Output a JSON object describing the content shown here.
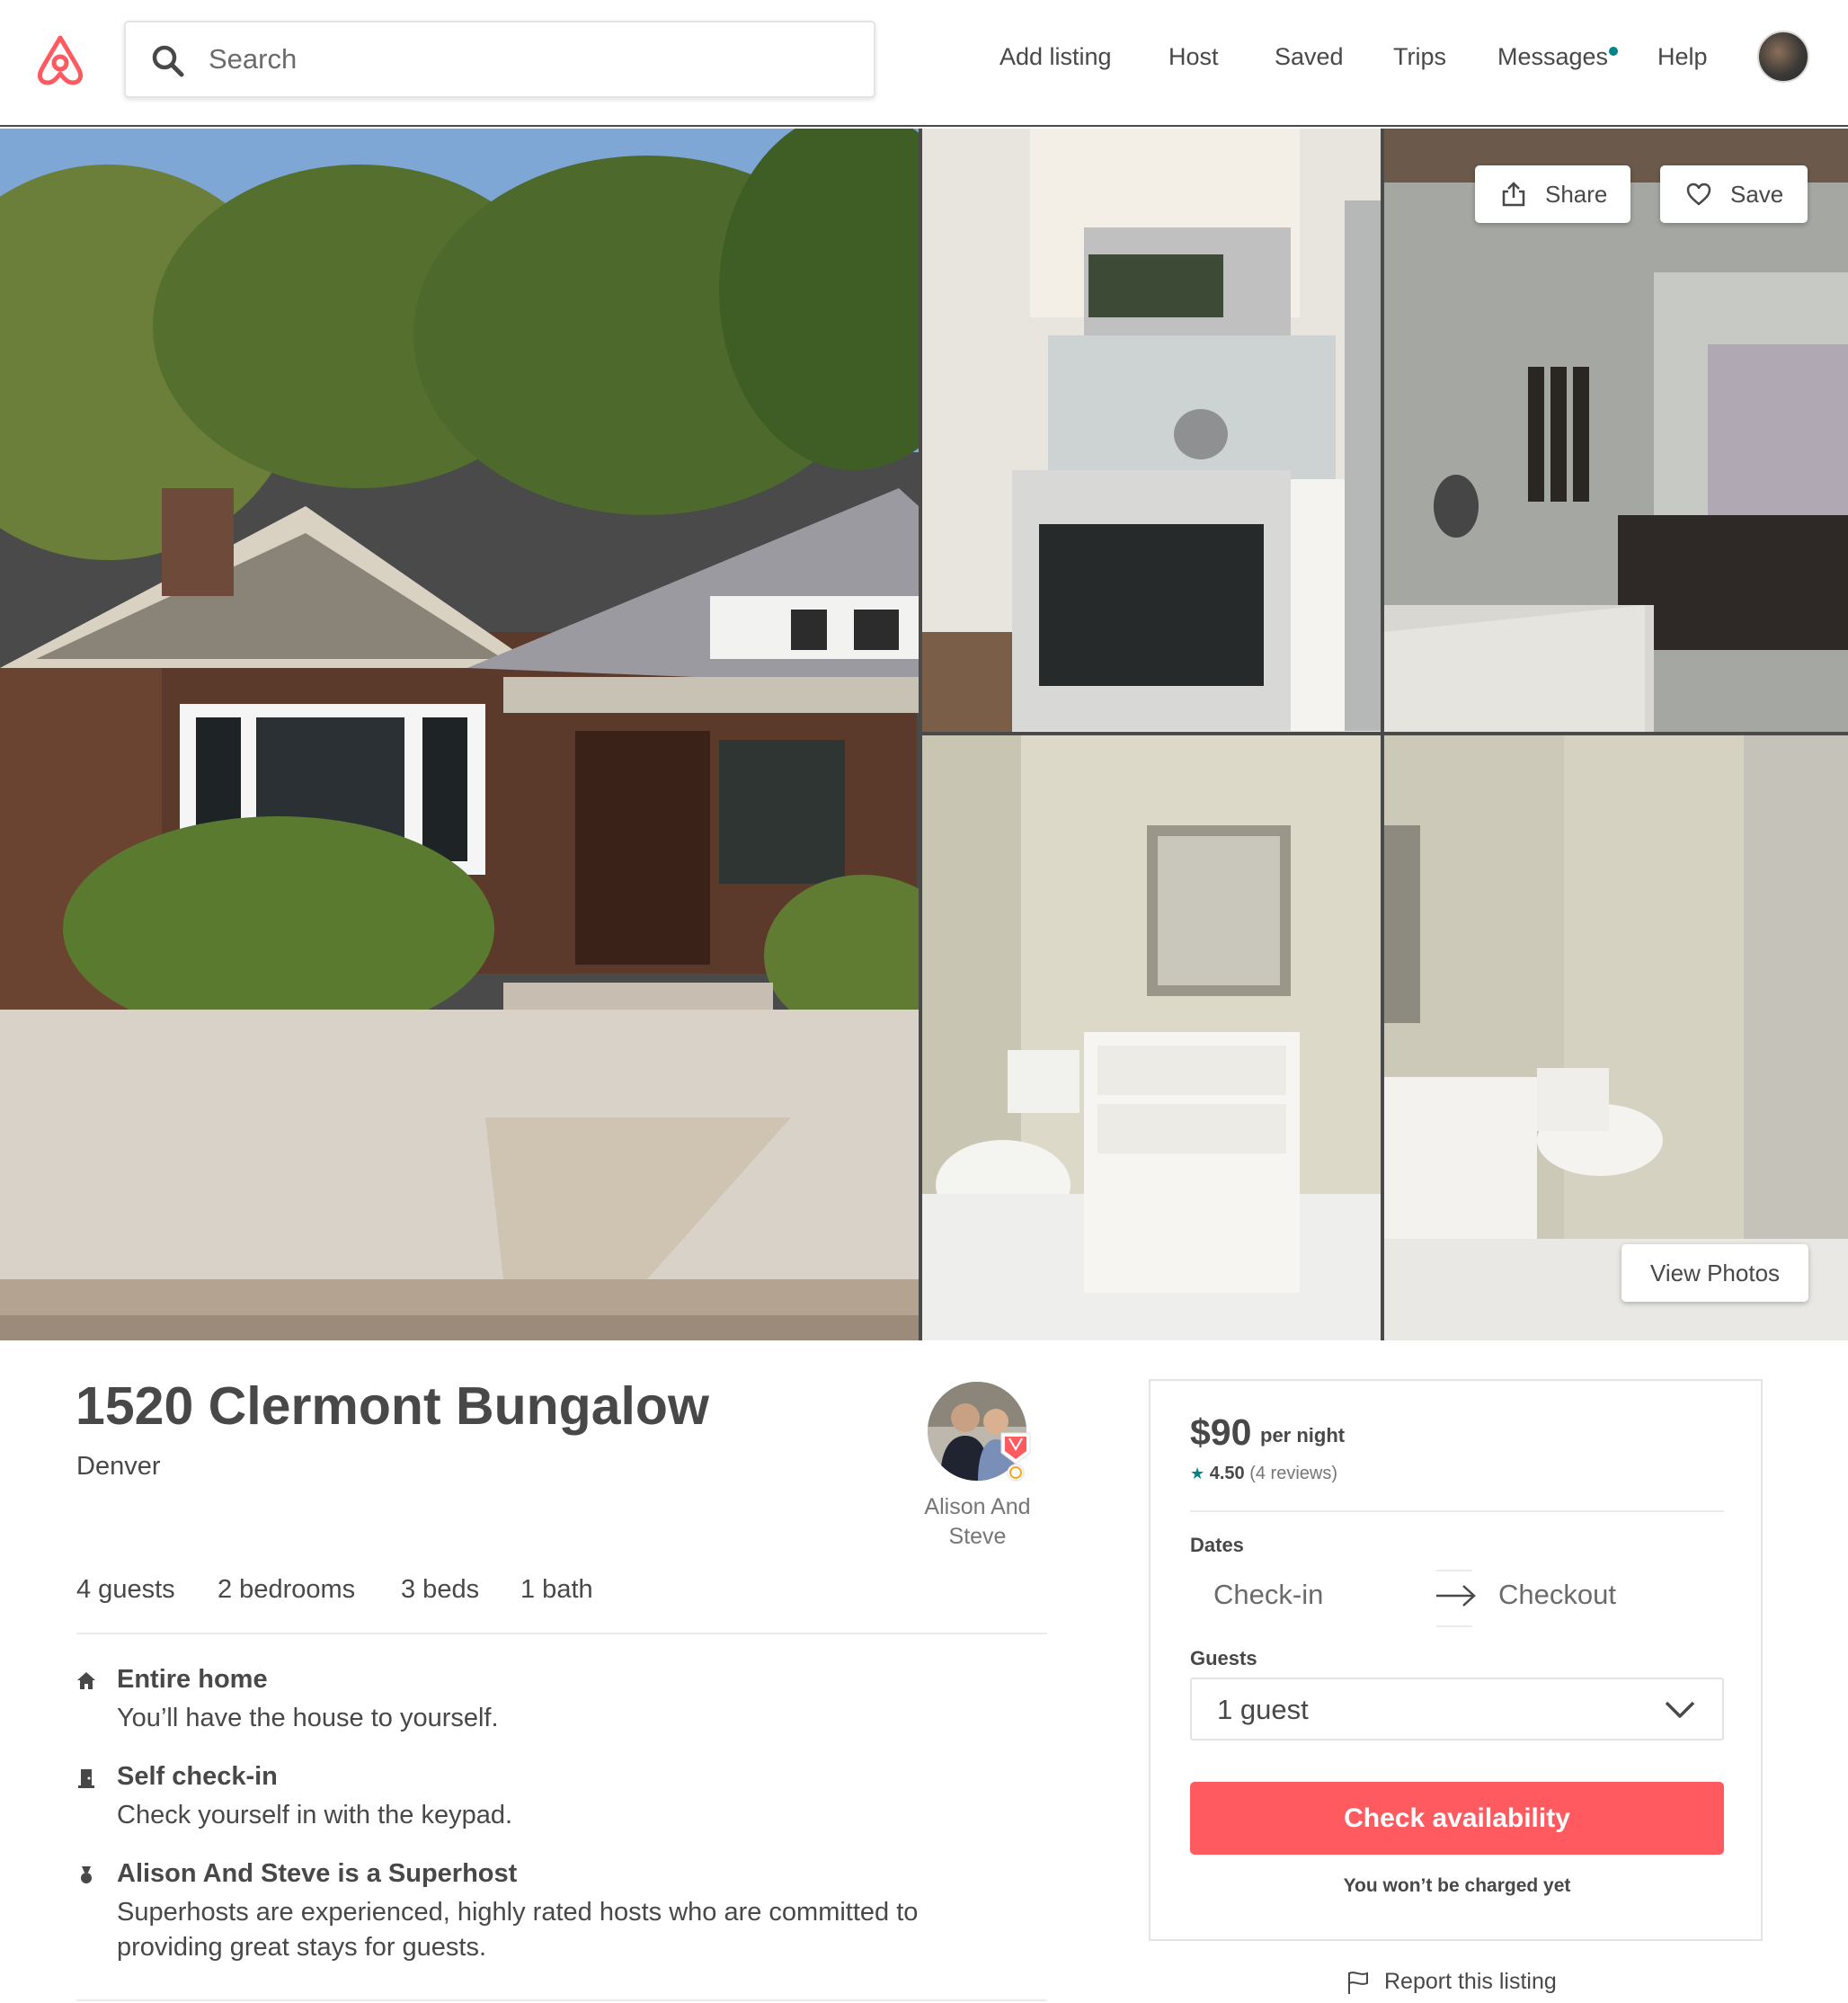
{
  "header": {
    "logo": "airbnb-logo",
    "search": {
      "placeholder": "Search"
    },
    "nav": [
      "Add listing",
      "Host",
      "Saved",
      "Trips",
      "Messages",
      "Help"
    ]
  },
  "gallery": {
    "share_label": "Share",
    "save_label": "Save",
    "view_photos_label": "View Photos"
  },
  "listing": {
    "title": "1520 Clermont Bungalow",
    "city": "Denver",
    "host_name": "Alison And Steve",
    "stats": [
      "4 guests",
      "2 bedrooms",
      "3 beds",
      "1 bath"
    ],
    "features": [
      {
        "icon": "home-icon",
        "title": "Entire home",
        "desc": "You’ll have the house to yourself."
      },
      {
        "icon": "door-icon",
        "title": "Self check-in",
        "desc": "Check yourself in with the keypad."
      },
      {
        "icon": "medal-icon",
        "title": "Alison And Steve is a Superhost",
        "desc": "Superhosts are experienced, highly rated hosts who are committed to providing great stays for guests."
      }
    ]
  },
  "booking": {
    "price": "$90",
    "per_night": "per night",
    "rating_star": "★",
    "rating": "4.50",
    "reviews": "(4 reviews)",
    "dates_label": "Dates",
    "checkin_placeholder": "Check-in",
    "checkout_placeholder": "Checkout",
    "guests_label": "Guests",
    "guests_value": "1 guest",
    "cta_label": "Check availability",
    "no_charge_note": "You won’t be charged yet",
    "report_label": "Report this listing"
  },
  "colors": {
    "brand": "#FF5A5F",
    "text": "#484848",
    "accent": "#008489"
  }
}
